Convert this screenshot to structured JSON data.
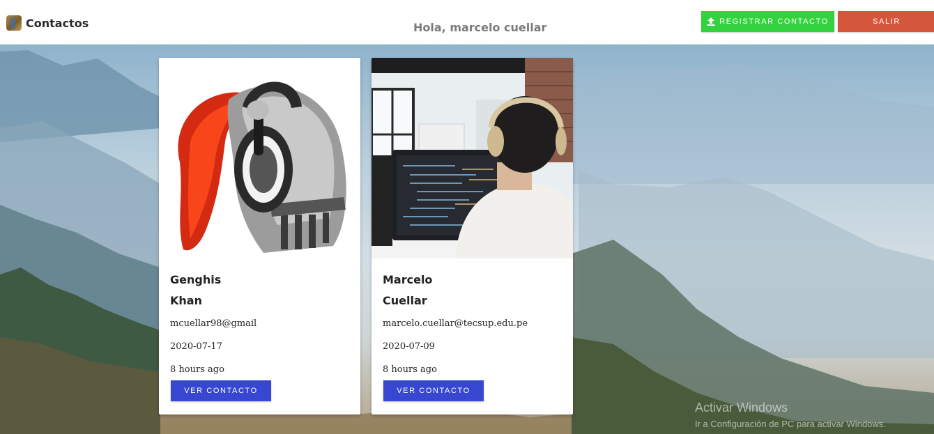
{
  "navbar": {
    "brand": "Contactos",
    "greeting": "Hola, marcelo cuellar",
    "register_label": "REGISTRAR CONTACTO",
    "logout_label": "SALIR"
  },
  "contacts": [
    {
      "first_name": "Genghis",
      "last_name": "Khan",
      "email": "mcuellar98@gmail",
      "date": "2020-07-17",
      "ago": "8 hours ago",
      "button_label": "VER CONTACTO"
    },
    {
      "first_name": "Marcelo",
      "last_name": "Cuellar",
      "email": "marcelo.cuellar@tecsup.edu.pe",
      "date": "2020-07-09",
      "ago": "8 hours ago",
      "button_label": "VER CONTACTO"
    }
  ],
  "watermark": {
    "title": "Activar Windows",
    "subtitle": "Ir a Configuración de PC para activar Windows."
  },
  "colors": {
    "register_button": "#34d23e",
    "logout_button": "#d5573b",
    "view_button": "#3747d2"
  },
  "icons": {
    "brand": "contacts-book-icon",
    "register": "upload-icon"
  }
}
